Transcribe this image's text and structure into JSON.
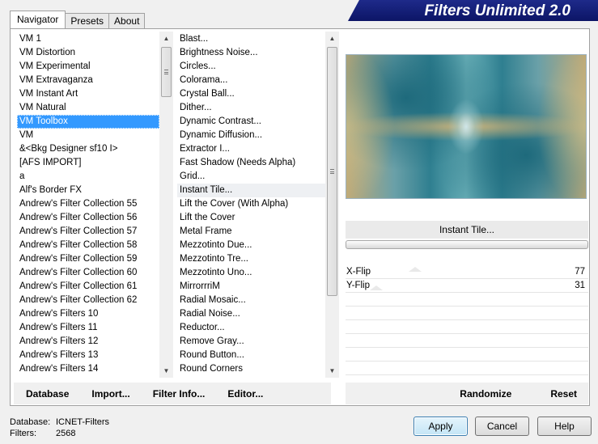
{
  "brand": {
    "title": "Filters Unlimited 2.0"
  },
  "tabs": [
    {
      "label": "Navigator",
      "active": true
    },
    {
      "label": "Presets",
      "active": false
    },
    {
      "label": "About",
      "active": false
    }
  ],
  "categories": {
    "selected_index": 6,
    "items": [
      "VM 1",
      "VM Distortion",
      "VM Experimental",
      "VM Extravaganza",
      "VM Instant Art",
      "VM Natural",
      "VM Toolbox",
      "VM",
      "&<Bkg Designer sf10 I>",
      "[AFS IMPORT]",
      "a",
      "Alf's Border FX",
      "Andrew's Filter Collection 55",
      "Andrew's Filter Collection 56",
      "Andrew's Filter Collection 57",
      "Andrew's Filter Collection 58",
      "Andrew's Filter Collection 59",
      "Andrew's Filter Collection 60",
      "Andrew's Filter Collection 61",
      "Andrew's Filter Collection 62",
      "Andrew's Filters 10",
      "Andrew's Filters 11",
      "Andrew's Filters 12",
      "Andrew's Filters 13",
      "Andrew's Filters 14"
    ]
  },
  "filters": {
    "highlighted_index": 11,
    "items": [
      "Blast...",
      "Brightness Noise...",
      "Circles...",
      "Colorama...",
      "Crystal Ball...",
      "Dither...",
      "Dynamic Contrast...",
      "Dynamic Diffusion...",
      "Extractor I...",
      "Fast Shadow (Needs Alpha)",
      "Grid...",
      "Instant Tile...",
      "Lift the Cover (With Alpha)",
      "Lift the Cover",
      "Metal Frame",
      "Mezzotinto Due...",
      "Mezzotinto Tre...",
      "Mezzotinto Uno...",
      "MirrorrriM",
      "Radial Mosaic...",
      "Radial Noise...",
      "Reductor...",
      "Remove Gray...",
      "Round Button...",
      "Round Corners"
    ]
  },
  "preview": {
    "filter_name": "Instant Tile..."
  },
  "params": [
    {
      "label": "X-Flip",
      "value": "77"
    },
    {
      "label": "Y-Flip",
      "value": "31"
    }
  ],
  "bottom_left": {
    "database": "Database",
    "import": "Import...",
    "filter_info": "Filter Info...",
    "editor": "Editor..."
  },
  "bottom_right": {
    "randomize": "Randomize",
    "reset": "Reset"
  },
  "status": {
    "database_label": "Database:",
    "database_value": "ICNET-Filters",
    "filters_label": "Filters:",
    "filters_value": "2568"
  },
  "buttons": {
    "apply": "Apply",
    "cancel": "Cancel",
    "help": "Help"
  }
}
